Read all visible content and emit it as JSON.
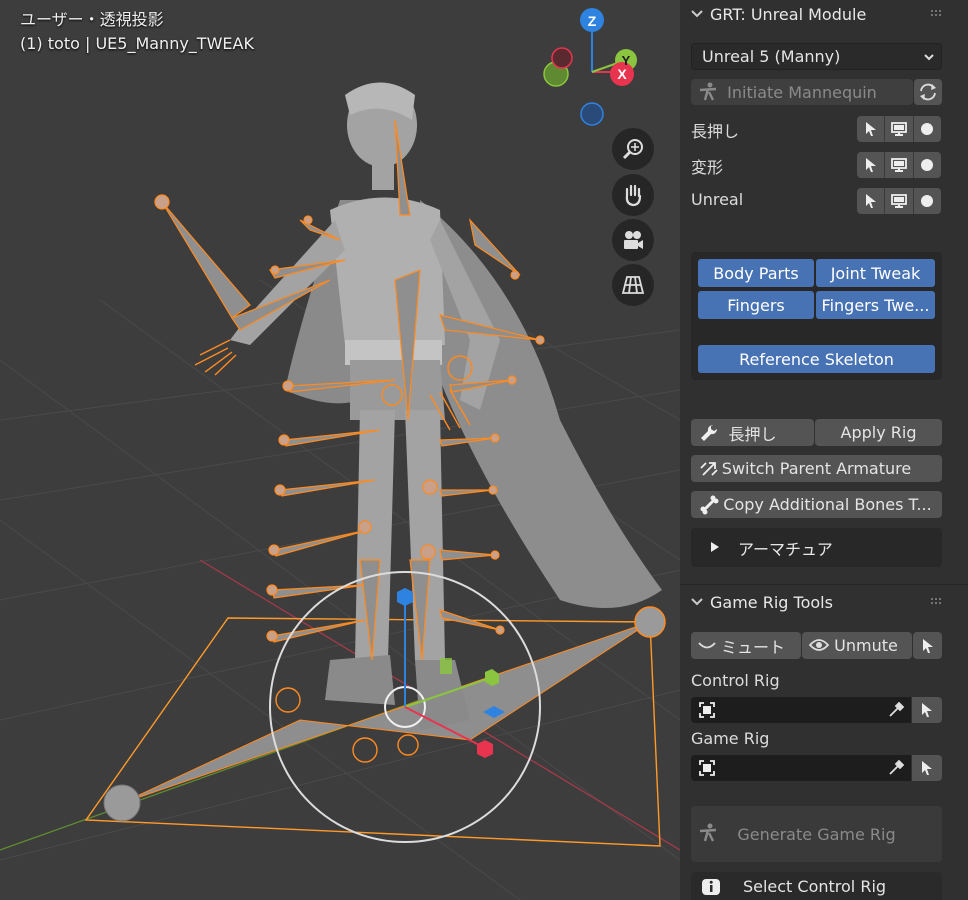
{
  "viewport": {
    "title": "ユーザー・透視投影",
    "subtitle": "(1) toto | UE5_Manny_TWEAK",
    "gizmo": {
      "z_label": "Z",
      "y_label": "Y",
      "x_label": "X"
    }
  },
  "grt_panel": {
    "title": "GRT: Unreal Module",
    "mannequin_select": "Unreal 5 (Manny)",
    "initiate_label": "Initiate Mannequin",
    "rows": [
      {
        "label": "長押し"
      },
      {
        "label": "変形"
      },
      {
        "label": "Unreal"
      }
    ],
    "body_parts": "Body Parts",
    "joint_tweak": "Joint Tweak",
    "fingers": "Fingers",
    "fingers_tweak": "Fingers Twe...",
    "reference_skeleton": "Reference Skeleton",
    "hold_label": "長押し",
    "apply_rig": "Apply Rig",
    "switch_parent": "Switch Parent Armature",
    "copy_bones": "Copy Additional Bones T...",
    "armature_label": "アーマチュア"
  },
  "game_rig_panel": {
    "title": "Game Rig Tools",
    "mute_label": "ミュート",
    "unmute_label": "Unmute",
    "control_rig_label": "Control Rig",
    "game_rig_label": "Game Rig",
    "generate_label": "Generate Game Rig",
    "select_control_label": "Select Control Rig"
  },
  "colors": {
    "accent_blue": "#4772b3",
    "bone_orange": "#ff8a1f",
    "axis_x": "#e8344e",
    "axis_y": "#8bc53f",
    "axis_z": "#2f83e0"
  }
}
